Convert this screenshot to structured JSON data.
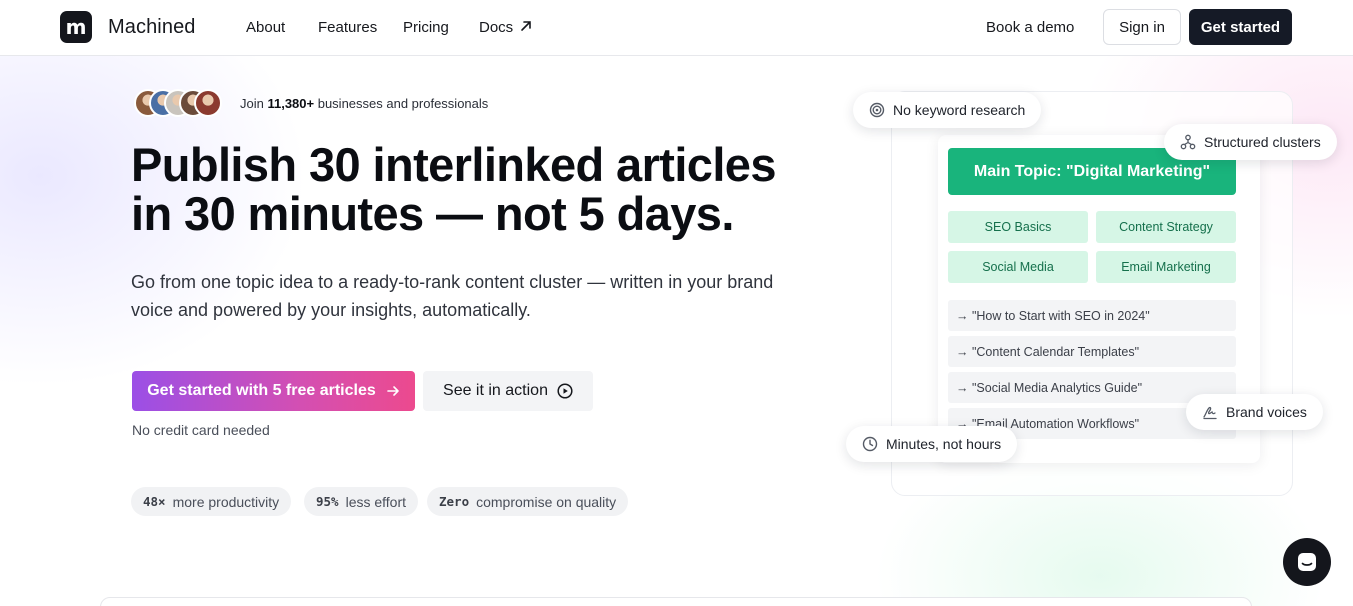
{
  "brand": {
    "logo_mark": "m",
    "name": "Machined"
  },
  "nav": {
    "links": [
      "About",
      "Features",
      "Pricing",
      "Docs"
    ],
    "book_demo": "Book a demo",
    "sign_in": "Sign in",
    "get_started": "Get started"
  },
  "social_proof": {
    "prefix": "Join ",
    "count": "11,380+",
    "suffix": " businesses and professionals",
    "avatar_colors": [
      "#8a5a3c",
      "#4a6fa5",
      "#c9c4bd",
      "#6b4b3a",
      "#8b3a2f"
    ]
  },
  "hero": {
    "headline_line1": "Publish 30 interlinked articles",
    "headline_line2": "in 30 minutes — not 5 days.",
    "subhead": "Go from one topic idea to a ready-to-rank content cluster — written in your brand voice and powered by your insights, automatically.",
    "cta_primary": "Get started with 5 free articles",
    "cta_secondary": "See it in action",
    "no_card": "No credit card needed"
  },
  "stats": [
    {
      "value": "48×",
      "label": "more productivity"
    },
    {
      "value": "95%",
      "label": "less effort"
    },
    {
      "value": "Zero",
      "label": "compromise on quality"
    }
  ],
  "cluster": {
    "main_topic": "Main Topic: \"Digital Marketing\"",
    "subtopics": [
      "SEO Basics",
      "Content Strategy",
      "Social Media",
      "Email Marketing"
    ],
    "articles": [
      "→ \"How to Start with SEO in 2024\"",
      "→ \"Content Calendar Templates\"",
      "→ \"Social Media Analytics Guide\"",
      "→ \"Email Automation Workflows\""
    ],
    "badges": {
      "keyword": "No keyword research",
      "clusters": "Structured clusters",
      "voices": "Brand voices",
      "minutes": "Minutes, not hours"
    }
  },
  "colors": {
    "accent_green": "#19b47c",
    "cta_gradient_start": "#9b4fe6",
    "cta_gradient_end": "#ec4a8e",
    "dark": "#14161c"
  }
}
